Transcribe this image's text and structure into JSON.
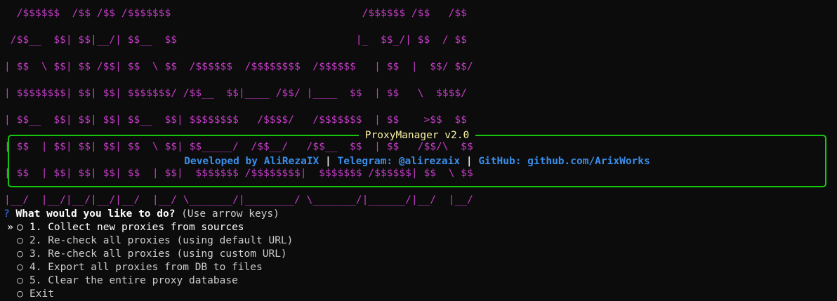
{
  "banner": {
    "lines": [
      "  /$$$$$$  /$$ /$$ /$$$$$$$                               /$$$$$$ /$$   /$$",
      " /$$__  $$| $$|__/| $$__  $$                             |_  $$_/| $$  / $$",
      "| $$  \\ $$| $$ /$$| $$  \\ $$  /$$$$$$  /$$$$$$$$  /$$$$$$   | $$  |  $$/ $$/",
      "| $$$$$$$$| $$| $$| $$$$$$$/ /$$__  $$|____ /$$/ |____  $$  | $$   \\  $$$$/",
      "| $$__  $$| $$| $$| $$__  $$| $$$$$$$$   /$$$$/   /$$$$$$$  | $$    >$$  $$",
      "| $$  | $$| $$| $$| $$  \\ $$| $$_____/  /$$__/   /$$__  $$  | $$   /$$/\\  $$",
      "| $$  | $$| $$| $$| $$  | $$|  $$$$$$$ /$$$$$$$$|  $$$$$$$ /$$$$$$| $$  \\ $$",
      "|__/  |__/|__/|__/|__/  |__/ \\_______/|________/ \\_______/|______/|__/  |__/"
    ]
  },
  "panel": {
    "title": "ProxyManager v2.0",
    "developed_label": "Developed by AliRezaIX",
    "separator": "|",
    "telegram_label": "Telegram: @alirezaix",
    "github_label": "GitHub: github.com/ArixWorks"
  },
  "prompt": {
    "qmark": "?",
    "question": "What would you like to do?",
    "hint": "(Use arrow keys)"
  },
  "menu": {
    "pointer": "»",
    "bullet": "○",
    "items": [
      {
        "label": "1. Collect new proxies from sources"
      },
      {
        "label": "2. Re-check all proxies (using default URL)"
      },
      {
        "label": "3. Re-check all proxies (using custom URL)"
      },
      {
        "label": "4. Export all proxies from DB to files"
      },
      {
        "label": "5. Clear the entire proxy database"
      },
      {
        "label": "Exit"
      }
    ],
    "selected_index": 0
  },
  "colors": {
    "banner": "#c43dc7",
    "border": "#16c60c",
    "title": "#f9f1a5",
    "credits": "#3b8eea",
    "background": "#0c0c0c"
  }
}
